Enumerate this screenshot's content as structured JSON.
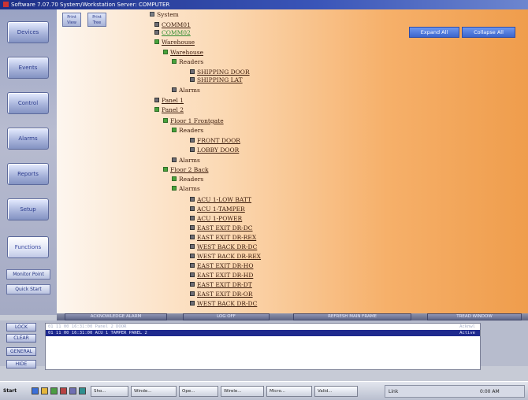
{
  "window": {
    "title": "Software 7.07.70 System/Workstation Server: COMPUTER"
  },
  "sidebar": {
    "nav": [
      "Devices",
      "Events",
      "Control",
      "Alarms",
      "Reports",
      "Setup",
      "Functions"
    ],
    "small_buttons": [
      "Monitor Point",
      "Quick Start"
    ]
  },
  "toolbar": {
    "buttons": [
      "Print View",
      "Print Tree"
    ],
    "expand_all": "Expand All",
    "collapse_all": "Collapse All"
  },
  "tree": [
    {
      "label": "System",
      "box": "gray",
      "style": "plain"
    },
    {
      "label": "COMM01",
      "box": "dark",
      "style": "link"
    },
    {
      "label": "COMM02",
      "box": "dark",
      "style": "green"
    },
    {
      "label": "Warehouse",
      "box": "green",
      "style": "link"
    },
    {
      "label": "Warehouse",
      "box": "green",
      "style": "link"
    },
    {
      "label": "Readers",
      "box": "green",
      "style": "plain"
    },
    {
      "label": "SHIPPING DOOR",
      "box": "dark",
      "style": "link"
    },
    {
      "label": "SHIPPING LAT",
      "box": "dark",
      "style": "link"
    },
    {
      "label": "Alarms",
      "box": "dark",
      "style": "plain"
    },
    {
      "label": "Panel 1",
      "box": "dark",
      "style": "link"
    },
    {
      "label": "Panel 2",
      "box": "green",
      "style": "link"
    },
    {
      "label": "Floor 1 Frontgate",
      "box": "green",
      "style": "link"
    },
    {
      "label": "Readers",
      "box": "green",
      "style": "plain"
    },
    {
      "label": "FRONT DOOR",
      "box": "dark",
      "style": "link"
    },
    {
      "label": "LOBBY DOOR",
      "box": "dark",
      "style": "link"
    },
    {
      "label": "Alarms",
      "box": "dark",
      "style": "plain"
    },
    {
      "label": "Floor 2 Back",
      "box": "green",
      "style": "link"
    },
    {
      "label": "Readers",
      "box": "green",
      "style": "plain"
    },
    {
      "label": "Alarms",
      "box": "green",
      "style": "plain"
    },
    {
      "label": "ACU 1-LOW BATT",
      "box": "dark",
      "style": "link"
    },
    {
      "label": "ACU 1-TAMPER",
      "box": "dark",
      "style": "link"
    },
    {
      "label": "ACU 1-POWER",
      "box": "dark",
      "style": "link"
    },
    {
      "label": "EAST EXIT DR-DC",
      "box": "dark",
      "style": "link"
    },
    {
      "label": "EAST EXIT DR-REX",
      "box": "dark",
      "style": "link"
    },
    {
      "label": "WEST BACK DR-DC",
      "box": "dark",
      "style": "link"
    },
    {
      "label": "WEST BACK DR-REX",
      "box": "dark",
      "style": "link"
    },
    {
      "label": "EAST EXIT DR-HO",
      "box": "dark",
      "style": "link"
    },
    {
      "label": "EAST EXIT DR-HD",
      "box": "dark",
      "style": "link"
    },
    {
      "label": "EAST EXIT DR-DT",
      "box": "dark",
      "style": "link"
    },
    {
      "label": "EAST EXIT DR-OR",
      "box": "dark",
      "style": "link"
    },
    {
      "label": "WEST BACK DR-DC",
      "box": "dark",
      "style": "link"
    }
  ],
  "tabs": [
    "ACKNOWLEDGE ALARM",
    "LOG OFF",
    "REFRESH MAIN FRAME",
    "TREAD WINDOW"
  ],
  "alarm_buttons": [
    "LOCK",
    "CLEAR",
    "GENERAL",
    "HIDE"
  ],
  "alarms": [
    {
      "text": "01 11 00 16:31:00   Panel 2   DOOR",
      "right": "Acknwl"
    },
    {
      "text": "01 11 00 16:31:00   ACU 1   TAMPER   PANEL 2",
      "right": "Active"
    }
  ],
  "taskbar": {
    "start": "Start",
    "tasks": [
      "Sho...",
      "Winde...",
      "Ope...",
      "Wirele...",
      "Micro...",
      "Valid..."
    ],
    "tray_items": [
      "Link",
      "0:00 AM"
    ]
  }
}
